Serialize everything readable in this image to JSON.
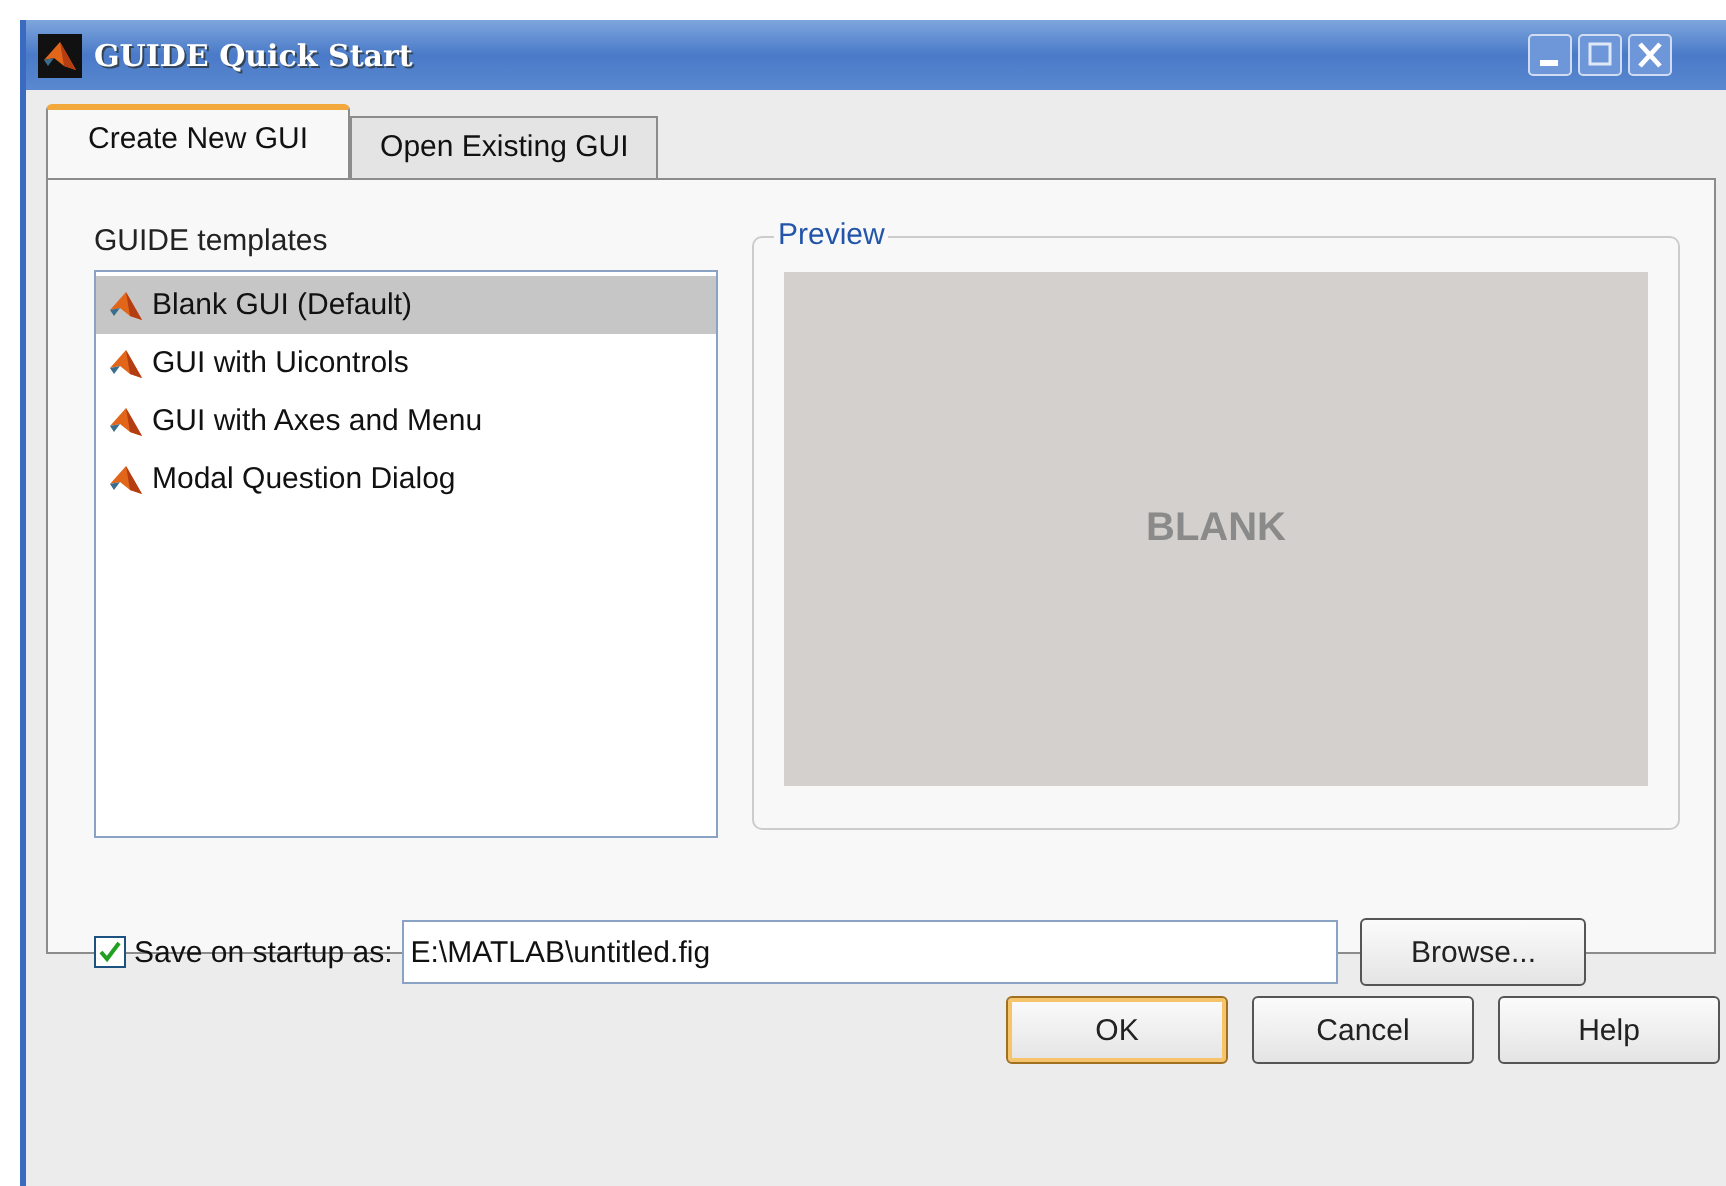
{
  "window": {
    "title": "GUIDE Quick Start"
  },
  "tabs": [
    {
      "label": "Create New GUI",
      "selected": true
    },
    {
      "label": "Open Existing GUI",
      "selected": false
    }
  ],
  "templates": {
    "label": "GUIDE templates",
    "items": [
      {
        "label": "Blank GUI (Default)",
        "selected": true
      },
      {
        "label": "GUI with Uicontrols",
        "selected": false
      },
      {
        "label": "GUI with Axes and Menu",
        "selected": false
      },
      {
        "label": "Modal Question Dialog",
        "selected": false
      }
    ]
  },
  "preview": {
    "label": "Preview",
    "text": "BLANK"
  },
  "save": {
    "label": "Save on startup as:",
    "checked": true,
    "value": "E:\\MATLAB\\untitled.fig",
    "button": "Browse..."
  },
  "buttons": [
    {
      "label": "OK",
      "default": true
    },
    {
      "label": "Cancel",
      "default": false
    },
    {
      "label": "Help",
      "default": false
    }
  ]
}
